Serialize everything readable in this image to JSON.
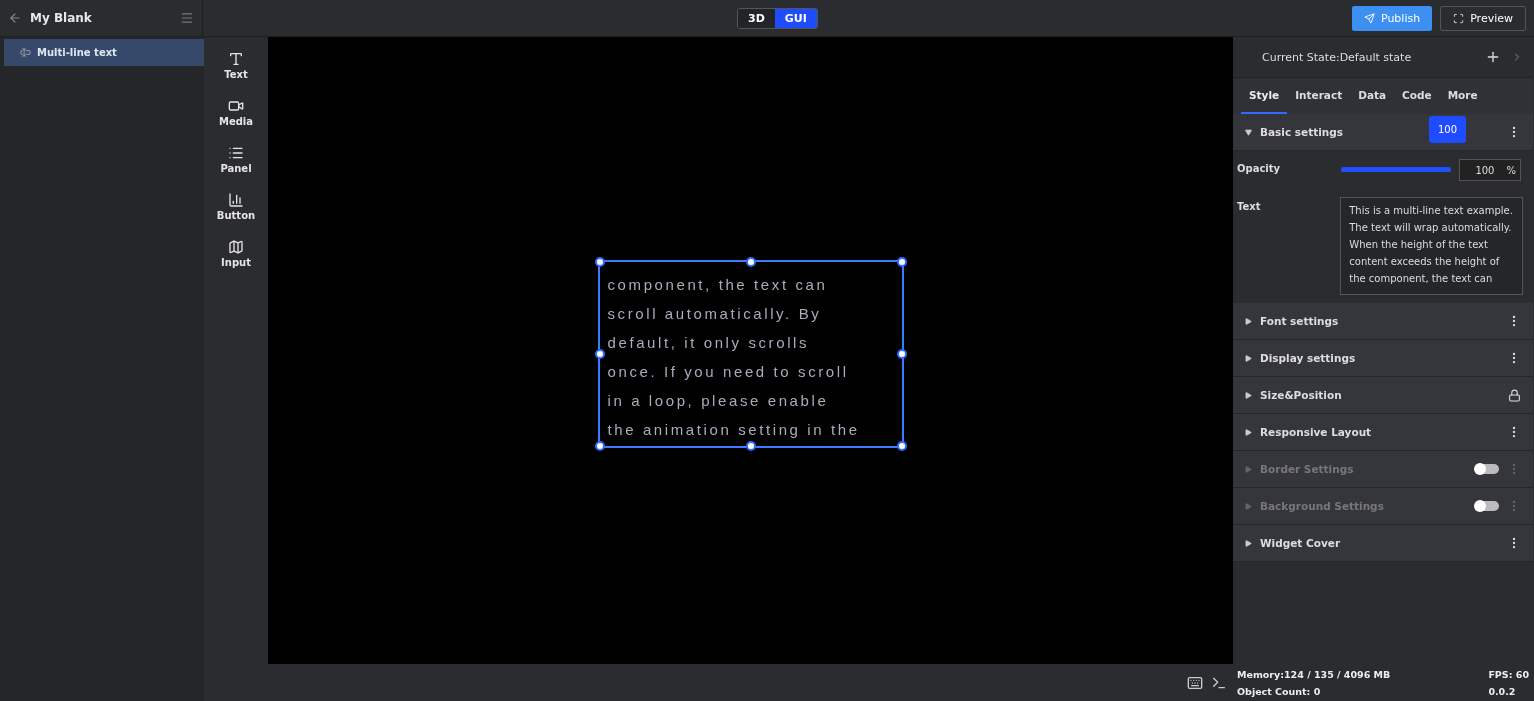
{
  "project": {
    "title": "My Blank"
  },
  "mode_toggle": [
    {
      "label": "3D",
      "selected": false
    },
    {
      "label": "GUI",
      "selected": true
    }
  ],
  "actions": {
    "publish": "Publish",
    "preview": "Preview"
  },
  "layers": [
    {
      "label": "Multi-line text",
      "selected": true
    }
  ],
  "widgets": [
    {
      "kind": "text",
      "label": "Text"
    },
    {
      "kind": "media",
      "label": "Media"
    },
    {
      "kind": "panel",
      "label": "Panel"
    },
    {
      "kind": "button",
      "label": "Button"
    },
    {
      "kind": "input",
      "label": "Input"
    }
  ],
  "canvas": {
    "lines": [
      "component, the text can",
      "scroll automatically. By",
      "default, it only scrolls",
      "once. If you need to scroll",
      "in a loop, please enable",
      "the animation setting in the"
    ]
  },
  "inspector": {
    "state": "Current State:Default state",
    "tabs": [
      {
        "label": "Style",
        "selected": true
      },
      {
        "label": "Interact",
        "selected": false
      },
      {
        "label": "Data",
        "selected": false
      },
      {
        "label": "Code",
        "selected": false
      },
      {
        "label": "More",
        "selected": false
      }
    ],
    "basic": {
      "title": "Basic settings",
      "expanded": true,
      "opacity_label": "Opacity",
      "opacity": {
        "level": 1,
        "tooltip": "100",
        "value": "100",
        "unit": "%"
      },
      "text_label": "Text",
      "text_value": "This is a multi-line text example. The text will wrap automatically. When the height of the text content exceeds the height of the component, the text can"
    },
    "sections": [
      {
        "title": "Font settings",
        "kind": "menu",
        "disabled": false
      },
      {
        "title": "Display settings",
        "kind": "menu",
        "disabled": false
      },
      {
        "title": "Size&Position",
        "kind": "lock",
        "disabled": false
      },
      {
        "title": "Responsive Layout",
        "kind": "menu",
        "disabled": false
      },
      {
        "title": "Border Settings",
        "kind": "toggle",
        "disabled": true,
        "on": false
      },
      {
        "title": "Background Settings",
        "kind": "toggle",
        "disabled": true,
        "on": false
      },
      {
        "title": "Widget Cover",
        "kind": "menu",
        "disabled": false
      }
    ]
  },
  "status": {
    "memory": "Memory:124 / 135 / 4096 MB",
    "fps": "FPS: 60",
    "objects": "Object Count: 0",
    "version": "0.0.2"
  }
}
